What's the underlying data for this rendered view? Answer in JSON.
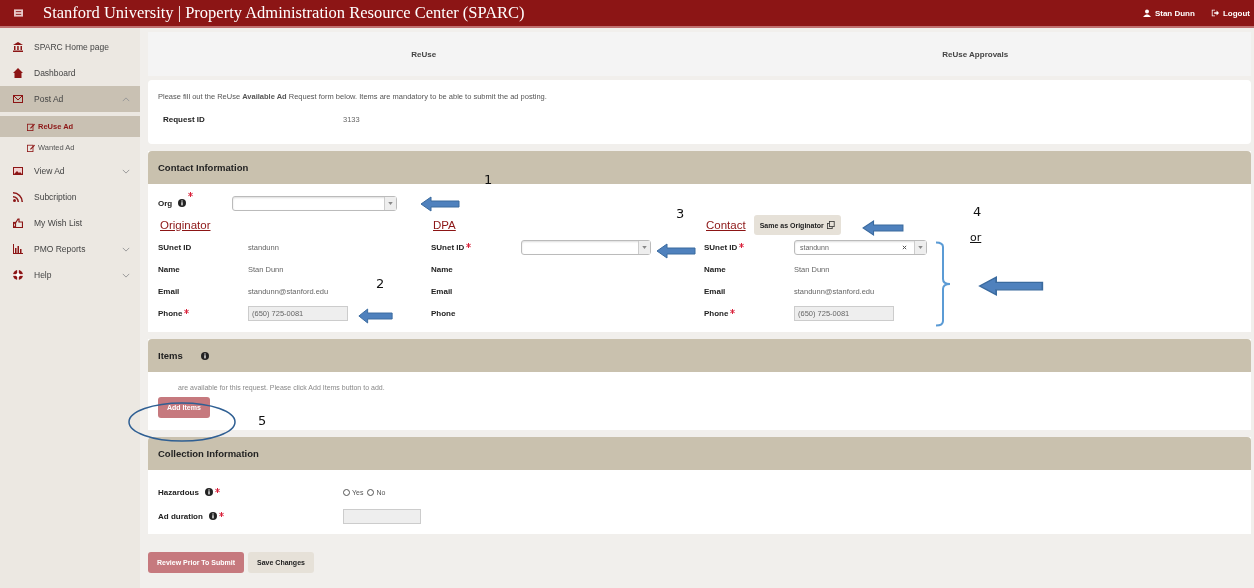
{
  "header": {
    "title": "Stanford University | Property Administration Resource Center (SPARC)",
    "user": "Stan Dunn",
    "logout": "Logout"
  },
  "sidebar": {
    "items": [
      {
        "label": "SPARC Home page",
        "selected": false
      },
      {
        "label": "Dashboard",
        "selected": false
      },
      {
        "label": "Post Ad",
        "selected": true,
        "expanded": true,
        "children": [
          {
            "label": "ReUse Ad",
            "selected": true
          },
          {
            "label": "Wanted Ad",
            "selected": false
          }
        ]
      },
      {
        "label": "View Ad",
        "selected": false,
        "expanded": false
      },
      {
        "label": "Subcription",
        "selected": false
      },
      {
        "label": "My Wish List",
        "selected": false
      },
      {
        "label": "PMO Reports",
        "selected": false,
        "expanded": false
      },
      {
        "label": "Help",
        "selected": false,
        "expanded": false
      }
    ]
  },
  "tabs": [
    {
      "label": "ReUse"
    },
    {
      "label": "ReUse Approvals"
    }
  ],
  "intro": {
    "text": "Please fill out the ReUse **Available Ad** Request form below. Items are mandatory to be able to submit the ad posting.",
    "request_id_label": "Request ID",
    "request_id": "3133"
  },
  "contact": {
    "title": "Contact Information",
    "org": {
      "label": "Org",
      "required": true
    },
    "columns": [
      {
        "heading": "Originator",
        "rows": [
          {
            "label": "SUnet ID",
            "kind": "text",
            "required": false,
            "value": "standunn"
          },
          {
            "label": "Name",
            "kind": "text",
            "required": false,
            "value": "Stan Dunn"
          },
          {
            "label": "Email",
            "kind": "text",
            "required": false,
            "value": "standunn@stanford.edu"
          },
          {
            "label": "Phone",
            "kind": "input",
            "required": true,
            "value": "(650) 725-0081"
          }
        ]
      },
      {
        "heading": "DPA",
        "rows": [
          {
            "label": "SUnet ID",
            "kind": "select",
            "required": true
          },
          {
            "label": "Name",
            "kind": "text",
            "required": false
          },
          {
            "label": "Email",
            "kind": "text",
            "required": false
          },
          {
            "label": "Phone",
            "kind": "text",
            "required": false
          }
        ]
      },
      {
        "heading": "Contact",
        "button": "Same as Originator",
        "rows": [
          {
            "label": "SUnet ID",
            "kind": "select",
            "required": true,
            "value": "standunn"
          },
          {
            "label": "Name",
            "kind": "text",
            "required": false,
            "value": "Stan Dunn"
          },
          {
            "label": "Email",
            "kind": "text",
            "required": false,
            "value": "standunn@stanford.edu"
          },
          {
            "label": "Phone",
            "kind": "input",
            "required": true,
            "value": "(650) 725-0081"
          }
        ]
      }
    ]
  },
  "items": {
    "title": "Items",
    "note": "are available for this request. Please click Add Items button to add.",
    "button": "Add Items"
  },
  "collection": {
    "title": "Collection Information",
    "fields": [
      {
        "label": "Hazardous",
        "kind": "radio",
        "required": true,
        "options": [
          {
            "label": "Yes",
            "selected": false
          },
          {
            "label": "No",
            "selected": false
          }
        ]
      },
      {
        "label": "Ad duration",
        "kind": "input",
        "required": true
      }
    ]
  },
  "actions": [
    {
      "label": "Review Prior To Submit",
      "kind": "primary"
    },
    {
      "label": "Save Changes",
      "kind": "default"
    }
  ],
  "annotations": [
    {
      "kind": "arrow"
    },
    {
      "kind": "number",
      "text": "1"
    },
    {
      "kind": "arrow"
    },
    {
      "kind": "number",
      "text": "2"
    },
    {
      "kind": "arrow"
    },
    {
      "kind": "number",
      "text": "3"
    },
    {
      "kind": "arrow"
    },
    {
      "kind": "number",
      "text": "4"
    },
    {
      "kind": "note",
      "text": "or"
    },
    {
      "kind": "bracket"
    },
    {
      "kind": "arrow"
    },
    {
      "kind": "ellipse"
    },
    {
      "kind": "number",
      "text": "5"
    }
  ]
}
